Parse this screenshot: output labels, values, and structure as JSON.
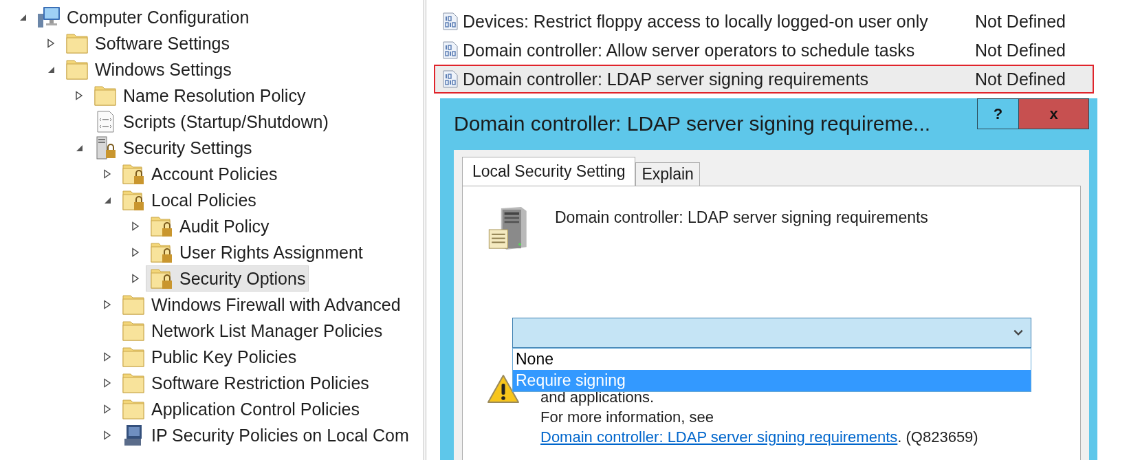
{
  "tree": [
    {
      "label": "Computer Configuration",
      "kind": "computer",
      "expanded": true,
      "selected": false,
      "children": [
        {
          "label": "Software Settings",
          "kind": "folder",
          "expanded": false,
          "selected": false
        },
        {
          "label": "Windows Settings",
          "kind": "folder",
          "expanded": true,
          "selected": false,
          "children": [
            {
              "label": "Name Resolution Policy",
              "kind": "folder",
              "expanded": false,
              "selected": false
            },
            {
              "label": "Scripts (Startup/Shutdown)",
              "kind": "script",
              "selected": false
            },
            {
              "label": "Security Settings",
              "kind": "security",
              "expanded": true,
              "selected": false,
              "children": [
                {
                  "label": "Account Policies",
                  "kind": "locked",
                  "expanded": false,
                  "selected": false
                },
                {
                  "label": "Local Policies",
                  "kind": "locked",
                  "expanded": true,
                  "selected": false,
                  "children": [
                    {
                      "label": "Audit Policy",
                      "kind": "locked",
                      "expanded": false,
                      "selected": false
                    },
                    {
                      "label": "User Rights Assignment",
                      "kind": "locked",
                      "expanded": false,
                      "selected": false
                    },
                    {
                      "label": "Security Options",
                      "kind": "locked",
                      "expanded": false,
                      "selected": true
                    }
                  ]
                },
                {
                  "label": "Windows Firewall with Advanced",
                  "kind": "folder",
                  "expanded": false,
                  "selected": false
                },
                {
                  "label": "Network List Manager Policies",
                  "kind": "folder",
                  "selected": false
                },
                {
                  "label": "Public Key Policies",
                  "kind": "folder",
                  "expanded": false,
                  "selected": false
                },
                {
                  "label": "Software Restriction Policies",
                  "kind": "folder",
                  "expanded": false,
                  "selected": false
                },
                {
                  "label": "Application Control Policies",
                  "kind": "folder",
                  "expanded": false,
                  "selected": false
                },
                {
                  "label": "IP Security Policies on Local Com",
                  "kind": "ipsec",
                  "expanded": false,
                  "selected": false
                }
              ]
            }
          ]
        }
      ]
    }
  ],
  "policies": [
    {
      "name": "Devices: Restrict floppy access to locally logged-on user only",
      "setting": "Not Defined",
      "selected": false
    },
    {
      "name": "Domain controller: Allow server operators to schedule tasks",
      "setting": "Not Defined",
      "selected": false
    },
    {
      "name": "Domain controller: LDAP server signing requirements",
      "setting": "Not Defined",
      "selected": true
    }
  ],
  "dialog": {
    "title": "Domain controller: LDAP server signing requireme...",
    "help": "?",
    "close": "x",
    "tabs": [
      {
        "label": "Local Security Setting",
        "selected": true
      },
      {
        "label": "Explain",
        "selected": false
      }
    ],
    "heading": "Domain controller: LDAP server signing requirements",
    "dropdown": {
      "options": [
        {
          "label": "None",
          "selected": false
        },
        {
          "label": "Require signing",
          "selected": true
        }
      ]
    },
    "warning": {
      "visible_line": "and applications.",
      "text": "For more information, see ",
      "link": "Domain controller: LDAP server signing requirements",
      "after": ". (Q823659)"
    }
  }
}
